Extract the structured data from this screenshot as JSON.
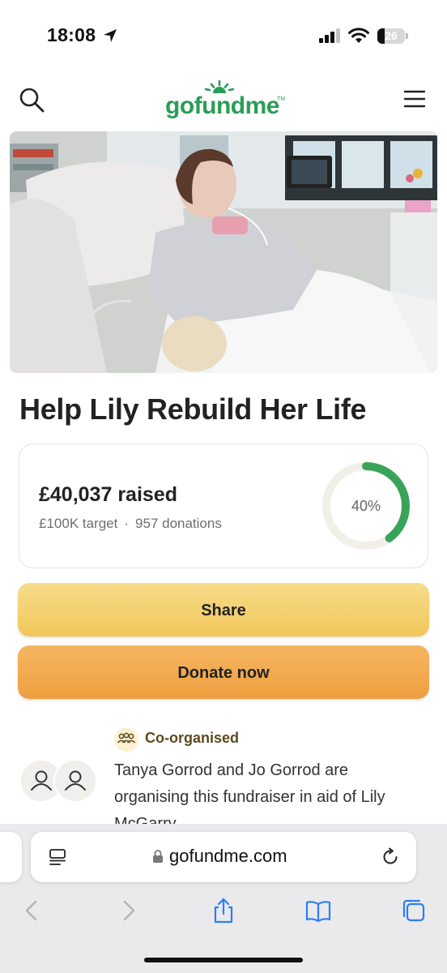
{
  "status_bar": {
    "time": "18:08",
    "battery": "26"
  },
  "header": {
    "logo_text": "gofundme",
    "logo_tm": "TM"
  },
  "campaign": {
    "title": "Help Lily Rebuild Her Life",
    "raised_amount": "£40,037",
    "raised_label": "raised",
    "target": "£100K target",
    "donations": "957 donations",
    "progress_fraction": 0.4,
    "progress_label": "40%"
  },
  "actions": {
    "share": "Share",
    "donate": "Donate now"
  },
  "organiser": {
    "badge": "Co-organised",
    "text": "Tanya Gorrod and Jo Gorrod are organising this fundraiser in aid of Lily McGarry"
  },
  "browser": {
    "url": "gofundme.com"
  },
  "colors": {
    "brand_green": "#2a9d55",
    "share_button": "#f1c75a",
    "donate_button": "#ee9f3f",
    "ios_blue": "#2f7cf6"
  }
}
